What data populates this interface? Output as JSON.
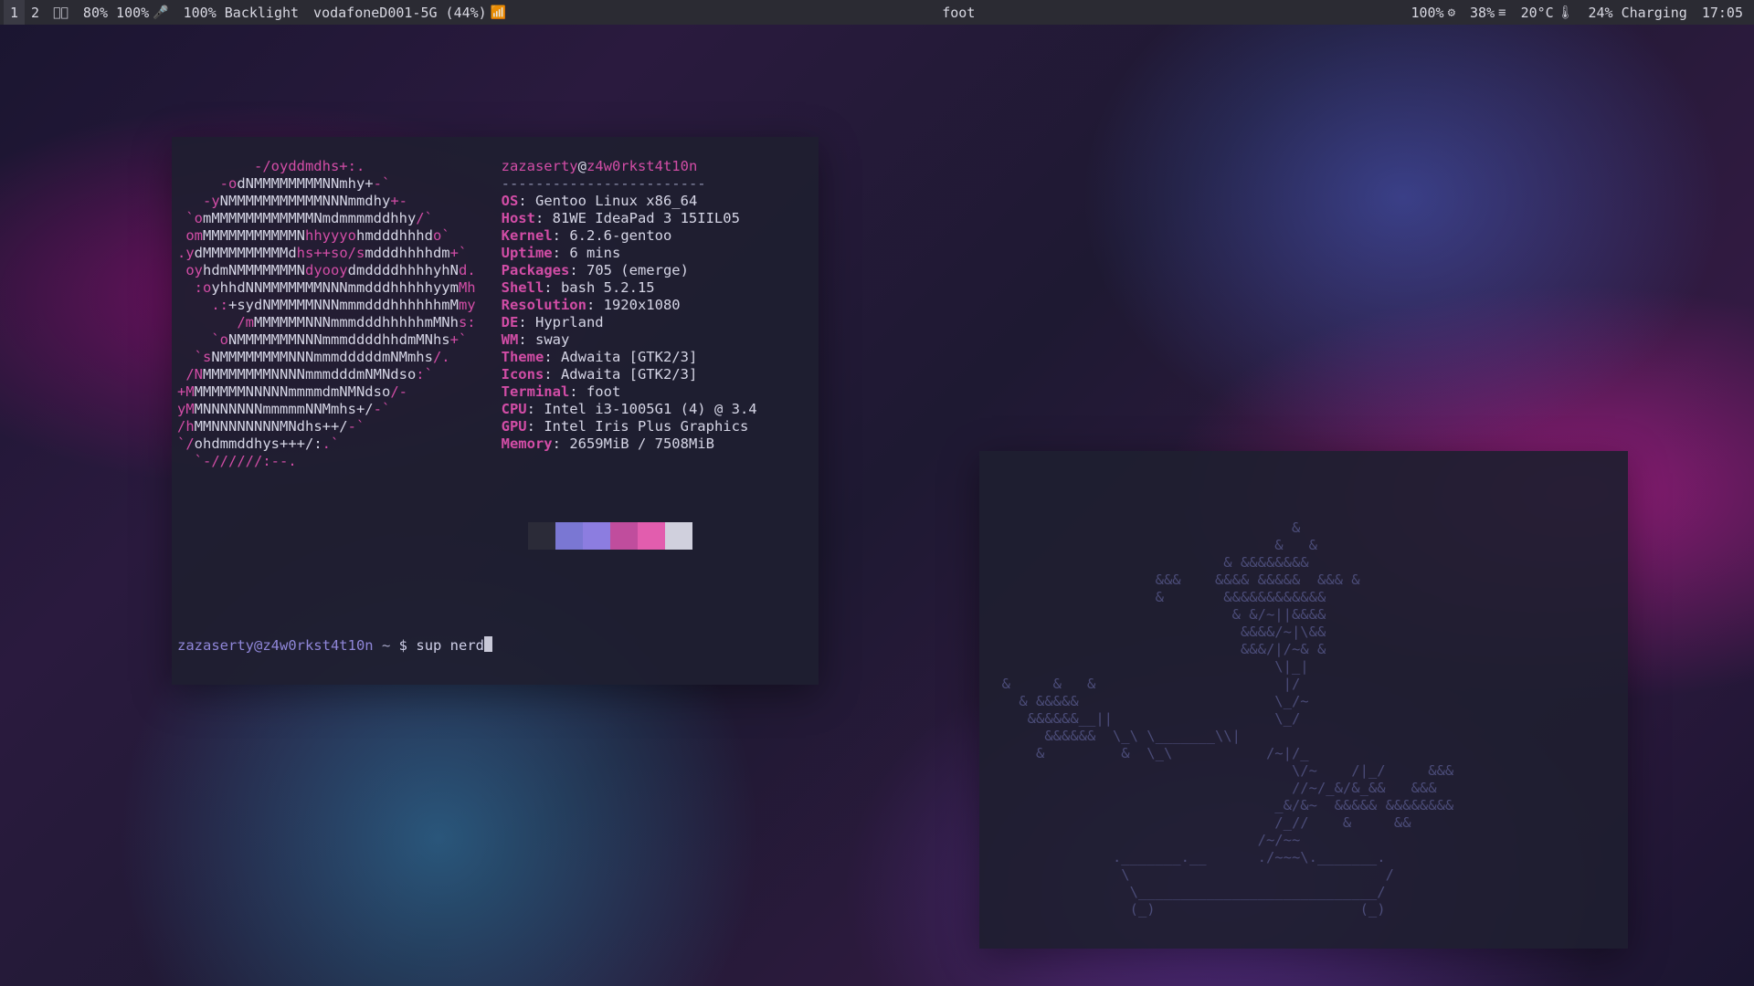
{
  "bar": {
    "workspaces": [
      "1",
      "2"
    ],
    "active_ws": 0,
    "volume": "80% 100%",
    "backlight": "100% Backlight",
    "wifi": "vodafoneD001-5G (44%)",
    "title": "foot",
    "cpu": "100%",
    "disk": "38%",
    "temp": "20°C",
    "battery": "24% Charging",
    "time": "17:05"
  },
  "neofetch": {
    "user": "zazaserty",
    "host": "z4w0rkst4t10n",
    "sep": "------------------------",
    "fields": [
      {
        "label": "OS",
        "value": "Gentoo Linux x86_64"
      },
      {
        "label": "Host",
        "value": "81WE IdeaPad 3 15IIL05"
      },
      {
        "label": "Kernel",
        "value": "6.2.6-gentoo"
      },
      {
        "label": "Uptime",
        "value": "6 mins"
      },
      {
        "label": "Packages",
        "value": "705 (emerge)"
      },
      {
        "label": "Shell",
        "value": "bash 5.2.15"
      },
      {
        "label": "Resolution",
        "value": "1920x1080"
      },
      {
        "label": "DE",
        "value": "Hyprland"
      },
      {
        "label": "WM",
        "value": "sway"
      },
      {
        "label": "Theme",
        "value": "Adwaita [GTK2/3]"
      },
      {
        "label": "Icons",
        "value": "Adwaita [GTK2/3]"
      },
      {
        "label": "Terminal",
        "value": "foot"
      },
      {
        "label": "CPU",
        "value": "Intel i3-1005G1 (4) @ 3.4"
      },
      {
        "label": "GPU",
        "value": "Intel Iris Plus Graphics"
      },
      {
        "label": "Memory",
        "value": "2659MiB / 7508MiB"
      }
    ],
    "swatches": [
      "#2b2b38",
      "#7a77d3",
      "#8c7de0",
      "#c04d9d",
      "#e25dae",
      "#d0d0dd"
    ]
  },
  "logo_lines": [
    {
      "pre": "         ",
      "m": "-/oyddmdhs+:.",
      "w": "",
      "post": ""
    },
    {
      "pre": "     ",
      "m": "-o",
      "w": "dNMMMMMMMMNNmhy+",
      "post": "-`"
    },
    {
      "pre": "   ",
      "m": "-y",
      "w": "NMMMMMMMMMMMNNNmmdhy",
      "post": "+-"
    },
    {
      "pre": " ",
      "m": "`o",
      "w": "mMMMMMMMMMMMMNmdmmmmddhhy",
      "post": "/`"
    },
    {
      "pre": " ",
      "m": "om",
      "w": "MMMMMMMMMMMN",
      "post": "hhyyyo",
      "w2": "hmdddhhhd",
      "post2": "o`"
    },
    {
      "pre": "",
      "m": ".y",
      "w": "dMMMMMMMMMMd",
      "post": "hs++so/s",
      "w2": "mdddhhhhdm",
      "post2": "+`"
    },
    {
      "pre": " ",
      "m": "oy",
      "w": "hdmNMMMMMMMN",
      "post": "dyooy",
      "w2": "dmddddhhhhyhN",
      "post2": "d."
    },
    {
      "pre": "  ",
      "m": ":o",
      "w": "yhhdNNMMMMMMMNNNmmdddhhhhhyym",
      "post": "Mh"
    },
    {
      "pre": "    ",
      "m": ".:",
      "w": "+sydNMMMMMNNNmmmdddhhhhhhmM",
      "post": "my"
    },
    {
      "pre": "       ",
      "m": "/m",
      "w": "MMMMMMNNNmmmdddhhhhhmMNh",
      "post": "s:"
    },
    {
      "pre": "    ",
      "m": "`o",
      "w": "NMMMMMMMNNNmmmddddhhdmMNhs",
      "post": "+`"
    },
    {
      "pre": "  ",
      "m": "`s",
      "w": "NMMMMMMMMNNNmmmdddddmNMmhs",
      "post": "/."
    },
    {
      "pre": " ",
      "m": "/N",
      "w": "MMMMMMMMNNNNmmmdddmNMNdso",
      "post": ":`"
    },
    {
      "pre": "",
      "m": "+M",
      "w": "MMMMMMNNNNNmmmmdmNMNdso",
      "post": "/-"
    },
    {
      "pre": "",
      "m": "yM",
      "w": "MNNNNNNNmmmmmNNMmhs+/",
      "post": "-`"
    },
    {
      "pre": "",
      "m": "/h",
      "w": "MMNNNNNNNNMNdhs++/",
      "post": "-`"
    },
    {
      "pre": "",
      "m": "`/",
      "w": "ohdmmddhys+++/:",
      "post": ".`"
    },
    {
      "pre": "  ",
      "m": "`-//////:--.",
      "w": "",
      "post": ""
    }
  ],
  "prompt": {
    "user_host": "zazaserty@z4w0rkst4t10n",
    "cwd": "~",
    "symbol": "$",
    "cmd": "sup nerd"
  },
  "bonsai": "                                    &\n                                  &   &\n                            & &&&&&&&&\n                    &&&    &&&& &&&&&  &&& &\n                    &       &&&&&&&&&&&&\n                             & &/~||&&&&\n                              &&&&/~|\\&&\n                              &&&/|/~& &\n                                  \\|_|\n  &     &   &                      |/\n    & &&&&&                       \\_/~\n     &&&&&&__||                   \\_/\n       &&&&&&  \\_\\ \\_______\\\\|\n      &         &  \\_\\           /~|/_\n                                    \\/~    /|_/     &&&\n                                    //~/_&/&_&&   &&&\n                                  _&/&~  &&&&& &&&&&&&&\n                                  /_//    &     &&\n                                /~/~~\n               ._______.__      ./~~~\\._______.\n                \\                              /\n                 \\____________________________/\n                 (_)                        (_)"
}
